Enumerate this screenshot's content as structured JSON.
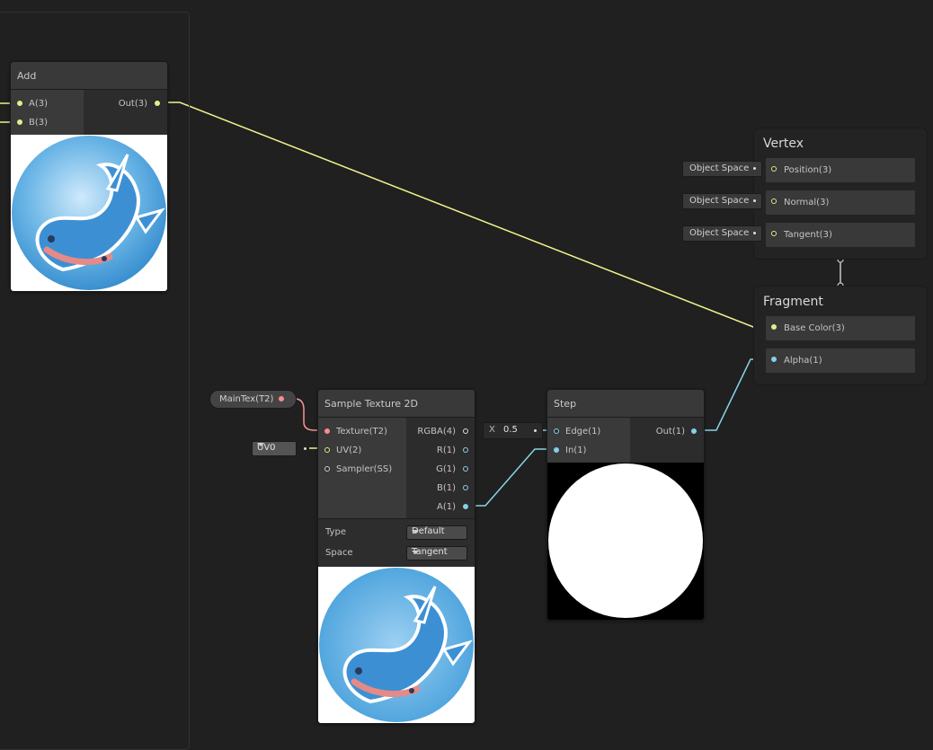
{
  "colors": {
    "canvas": "#202020",
    "vector3_port": "#e6ec8c",
    "vector1_port": "#87cfe8",
    "texture_port": "#ff8b8b",
    "wire_vector3": "#f1f38d",
    "wire_vector1": "#89d3ea",
    "wire_texture": "#f7948f"
  },
  "add_node": {
    "title": "Add",
    "inputs": [
      "A(3)",
      "B(3)"
    ],
    "output": "Out(3)",
    "preview_icon": "whale-shark-icon"
  },
  "vertex_context": {
    "title": "Vertex",
    "blocks": [
      {
        "label": "Position(3)",
        "space": "Object Space"
      },
      {
        "label": "Normal(3)",
        "space": "Object Space"
      },
      {
        "label": "Tangent(3)",
        "space": "Object Space"
      }
    ]
  },
  "fragment_context": {
    "title": "Fragment",
    "blocks": [
      {
        "label": "Base Color(3)"
      },
      {
        "label": "Alpha(1)"
      }
    ]
  },
  "maintex_property": {
    "label": "MainTex(T2)"
  },
  "uv_dropdown": {
    "value": "UV0"
  },
  "sample_texture": {
    "title": "Sample Texture 2D",
    "inputs": [
      "Texture(T2)",
      "UV(2)",
      "Sampler(SS)"
    ],
    "outputs": [
      "RGBA(4)",
      "R(1)",
      "G(1)",
      "B(1)",
      "A(1)"
    ],
    "type_label": "Type",
    "type_value": "Default",
    "space_label": "Space",
    "space_value": "Tangent",
    "preview_icon": "whale-shark-icon"
  },
  "step_node": {
    "title": "Step",
    "inputs": [
      "Edge(1)",
      "In(1)"
    ],
    "output": "Out(1)",
    "edge_field": {
      "axis": "X",
      "value": "0.5"
    }
  }
}
